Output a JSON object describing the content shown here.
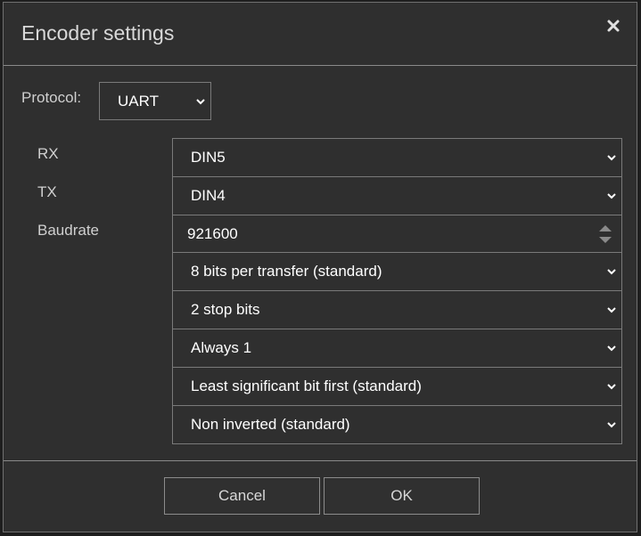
{
  "dialog": {
    "title": "Encoder settings",
    "close_icon": "close-icon"
  },
  "protocol": {
    "label": "Protocol:",
    "value": "UART"
  },
  "fields": {
    "rx_label": "RX",
    "tx_label": "TX",
    "baudrate_label": "Baudrate",
    "rx_value": "DIN5",
    "tx_value": "DIN4",
    "baudrate_value": "921600",
    "bits_value": "8 bits per transfer (standard)",
    "stop_bits_value": "2 stop bits",
    "parity_value": "Always 1",
    "bit_order_value": "Least significant bit first (standard)",
    "inversion_value": "Non inverted (standard)"
  },
  "buttons": {
    "cancel_label": "Cancel",
    "ok_label": "OK"
  },
  "colors": {
    "background": "#2f2f2f",
    "border": "#7a7a7a",
    "text": "#ffffff"
  }
}
